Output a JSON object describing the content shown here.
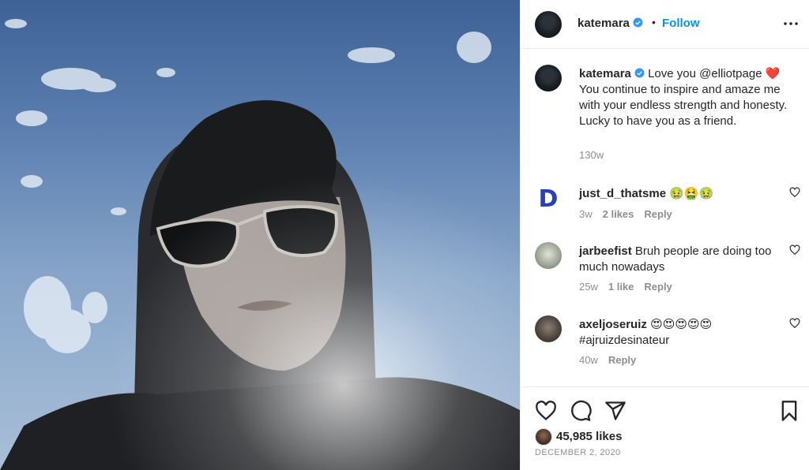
{
  "photo": {
    "alt": "selfie",
    "sky_color": "#5c7fb0"
  },
  "header": {
    "username": "katemara",
    "verified": true,
    "separator": "•",
    "follow_label": "Follow",
    "more_icon": "more-horizontal-icon"
  },
  "caption": {
    "username": "katemara",
    "verified": true,
    "text": "Love you @elliotpage ❤️\nYou continue to inspire and amaze me with your endless strength and honesty.\nLucky to have you as a friend.",
    "time": "130w"
  },
  "comments": [
    {
      "username": "just_d_thatsme",
      "text": "🤢🤮🤢",
      "time": "3w",
      "likes": "2 likes",
      "reply_label": "Reply"
    },
    {
      "username": "jarbeefist",
      "text": "Bruh people are doing too much nowadays",
      "time": "25w",
      "likes": "1 like",
      "reply_label": "Reply"
    },
    {
      "username": "axeljoseruiz",
      "text": "😍😍😍😍😍 #ajruizdesinateur",
      "time": "40w",
      "likes": "",
      "reply_label": "Reply"
    }
  ],
  "actions": {
    "like_icon": "heart-icon",
    "comment_icon": "comment-icon",
    "share_icon": "send-icon",
    "save_icon": "bookmark-icon",
    "likes_count": "45,985 likes",
    "date": "DECEMBER 2, 2020"
  },
  "colors": {
    "accent": "#0095f6",
    "verified": "#3897f0",
    "muted": "#8e8e8e"
  }
}
